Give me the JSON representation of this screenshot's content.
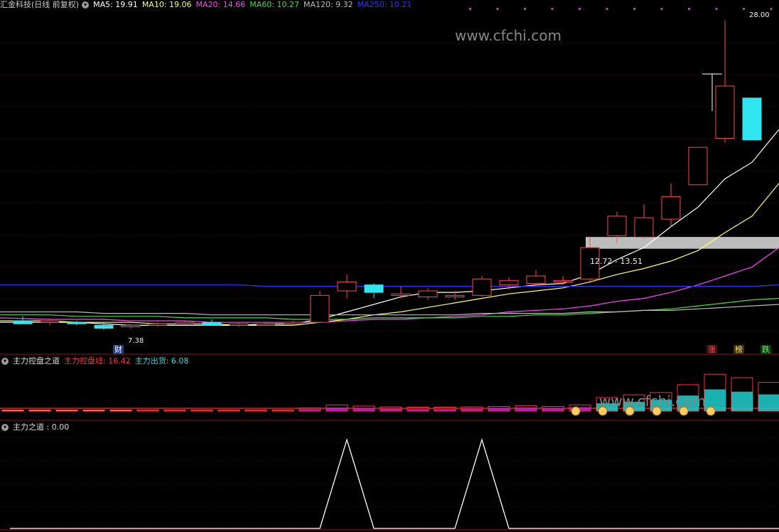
{
  "header": {
    "title": "汇金科技(日线 前复权)",
    "ma": [
      {
        "label": "MA5: 19.91",
        "color": "#ffffff"
      },
      {
        "label": "MA10: 19.06",
        "color": "#ffff66"
      },
      {
        "label": "MA20: 14.66",
        "color": "#ff44ff"
      },
      {
        "label": "MA60: 10.27",
        "color": "#44dd44"
      },
      {
        "label": "MA120: 9.32",
        "color": "#bbbbbb"
      },
      {
        "label": "MA250: 10.21",
        "color": "#3333ff"
      }
    ]
  },
  "price_panel": {
    "high_label": "28.00",
    "low_label": "7.38",
    "range_label": "12.72 - 13.51",
    "cai_label": "财",
    "right_tags": [
      {
        "label": "涨",
        "color": "#ff5555"
      },
      {
        "label": "榜",
        "color": "#ffdd55"
      },
      {
        "label": "跌",
        "color": "#55ff55"
      }
    ]
  },
  "sub1": {
    "title": "主力控盘之道",
    "line1": "主力控盘线: 16.42",
    "line2": "主力出货: 6.08"
  },
  "sub2": {
    "title": "主力之道 : 0.00"
  },
  "watermark": "www.cfchi.com",
  "chart_data": [
    {
      "type": "candlestick",
      "title": "汇金科技(日线 前复权)",
      "candles": [
        {
          "o": 7.9,
          "h": 8.2,
          "l": 7.7,
          "c": 7.7
        },
        {
          "o": 7.8,
          "h": 8.0,
          "l": 7.6,
          "c": 7.9
        },
        {
          "o": 7.8,
          "h": 7.9,
          "l": 7.6,
          "c": 7.7
        },
        {
          "o": 7.6,
          "h": 7.8,
          "l": 7.3,
          "c": 7.4
        },
        {
          "o": 7.5,
          "h": 7.7,
          "l": 7.38,
          "c": 7.6
        },
        {
          "o": 7.6,
          "h": 7.8,
          "l": 7.5,
          "c": 7.7
        },
        {
          "o": 7.7,
          "h": 7.9,
          "l": 7.6,
          "c": 7.8
        },
        {
          "o": 7.8,
          "h": 8.0,
          "l": 7.6,
          "c": 7.6
        },
        {
          "o": 7.6,
          "h": 7.8,
          "l": 7.5,
          "c": 7.7
        },
        {
          "o": 7.7,
          "h": 7.8,
          "l": 7.6,
          "c": 7.7
        },
        {
          "o": 7.7,
          "h": 7.9,
          "l": 7.6,
          "c": 7.8
        },
        {
          "o": 7.8,
          "h": 9.9,
          "l": 7.8,
          "c": 9.6
        },
        {
          "o": 9.9,
          "h": 11.0,
          "l": 9.4,
          "c": 10.5
        },
        {
          "o": 10.3,
          "h": 10.4,
          "l": 9.4,
          "c": 9.8
        },
        {
          "o": 9.6,
          "h": 10.2,
          "l": 9.4,
          "c": 9.7
        },
        {
          "o": 9.5,
          "h": 10.1,
          "l": 9.3,
          "c": 9.9
        },
        {
          "o": 9.5,
          "h": 9.9,
          "l": 9.3,
          "c": 9.6
        },
        {
          "o": 9.6,
          "h": 10.9,
          "l": 9.5,
          "c": 10.7
        },
        {
          "o": 10.3,
          "h": 10.8,
          "l": 10.0,
          "c": 10.6
        },
        {
          "o": 10.4,
          "h": 11.3,
          "l": 10.3,
          "c": 10.9
        },
        {
          "o": 10.5,
          "h": 10.9,
          "l": 10.3,
          "c": 10.6
        },
        {
          "o": 10.7,
          "h": 13.5,
          "l": 10.5,
          "c": 12.8
        },
        {
          "o": 13.6,
          "h": 15.2,
          "l": 13.1,
          "c": 14.9
        },
        {
          "o": 13.5,
          "h": 15.7,
          "l": 13.4,
          "c": 14.8
        },
        {
          "o": 14.7,
          "h": 17.1,
          "l": 14.2,
          "c": 16.2
        },
        {
          "o": 17.0,
          "h": 19.5,
          "l": 17.0,
          "c": 19.5
        },
        {
          "o": 20.1,
          "h": 28.0,
          "l": 19.8,
          "c": 23.6
        },
        {
          "o": 22.8,
          "h": 22.8,
          "l": 20.0,
          "c": 20.0
        }
      ],
      "ylim": [
        7.0,
        28.5
      ],
      "ma_lines": [
        {
          "name": "MA5",
          "values": [
            7.8,
            7.8,
            7.8,
            7.7,
            7.6,
            7.6,
            7.6,
            7.6,
            7.6,
            7.7,
            7.7,
            8.0,
            8.5,
            9.0,
            9.5,
            9.8,
            9.8,
            9.9,
            10.1,
            10.3,
            10.4,
            11.0,
            12.0,
            12.8,
            14.2,
            15.5,
            17.4,
            18.5
          ]
        },
        {
          "name": "MA10",
          "values": [
            7.9,
            7.9,
            7.8,
            7.8,
            7.8,
            7.7,
            7.7,
            7.7,
            7.6,
            7.6,
            7.6,
            7.8,
            8.0,
            8.3,
            8.5,
            8.8,
            9.1,
            9.4,
            9.7,
            9.9,
            10.1,
            10.5,
            11.0,
            11.4,
            11.9,
            12.6,
            13.8,
            14.9
          ]
        },
        {
          "name": "MA20",
          "values": [
            8.1,
            8.0,
            8.0,
            8.0,
            7.9,
            7.9,
            7.9,
            7.8,
            7.8,
            7.8,
            7.8,
            7.8,
            7.9,
            8.0,
            8.0,
            8.1,
            8.2,
            8.3,
            8.5,
            8.6,
            8.7,
            8.9,
            9.2,
            9.4,
            9.8,
            10.3,
            10.9,
            11.5
          ]
        },
        {
          "name": "MA60",
          "values": [
            8.3,
            8.3,
            8.2,
            8.2,
            8.2,
            8.2,
            8.1,
            8.1,
            8.1,
            8.1,
            8.0,
            8.0,
            8.0,
            8.1,
            8.1,
            8.1,
            8.1,
            8.2,
            8.2,
            8.3,
            8.3,
            8.4,
            8.5,
            8.6,
            8.7,
            8.9,
            9.1,
            9.3
          ]
        },
        {
          "name": "MA120",
          "values": [
            8.5,
            8.5,
            8.5,
            8.4,
            8.4,
            8.4,
            8.4,
            8.3,
            8.3,
            8.3,
            8.3,
            8.3,
            8.3,
            8.3,
            8.3,
            8.3,
            8.3,
            8.4,
            8.4,
            8.4,
            8.4,
            8.5,
            8.5,
            8.6,
            8.6,
            8.7,
            8.8,
            8.9
          ]
        },
        {
          "name": "MA250",
          "values": [
            10.3,
            10.3,
            10.3,
            10.3,
            10.3,
            10.3,
            10.3,
            10.3,
            10.3,
            10.2,
            10.2,
            10.2,
            10.2,
            10.2,
            10.2,
            10.2,
            10.2,
            10.2,
            10.2,
            10.2,
            10.2,
            10.2,
            10.2,
            10.2,
            10.2,
            10.2,
            10.2,
            10.2
          ]
        }
      ],
      "highlight_band": [
        12.72,
        13.51
      ]
    },
    {
      "type": "bar",
      "title": "主力控盘之道",
      "series": [
        {
          "name": "主力控盘线",
          "values": [
            0.3,
            0.3,
            0.3,
            0.3,
            0.3,
            0.3,
            0.3,
            0.3,
            0.3,
            0.3,
            0.3,
            0.8,
            1.6,
            1.3,
            1.1,
            1.0,
            1.0,
            1.1,
            1.2,
            1.4,
            1.2,
            1.6,
            3.5,
            4.2,
            4.8,
            6.8,
            9.5,
            8.6,
            7.4
          ]
        },
        {
          "name": "主力出货",
          "values": [
            0.2,
            0.2,
            0.2,
            0.2,
            0.2,
            0.1,
            0.1,
            0.1,
            0.1,
            0.1,
            0.1,
            0.5,
            0.9,
            0.7,
            0.6,
            0.5,
            0.5,
            0.6,
            0.8,
            0.9,
            0.7,
            1.0,
            2.0,
            2.4,
            2.9,
            4.0,
            5.6,
            5.0,
            4.3
          ]
        }
      ],
      "ylim": [
        0,
        11
      ]
    },
    {
      "type": "line",
      "title": "主力之道",
      "values": [
        0,
        0,
        0,
        0,
        0,
        0,
        0,
        0,
        0,
        0,
        0,
        0,
        1,
        0,
        0,
        0,
        0,
        1,
        0,
        0,
        0,
        0,
        0,
        0,
        0,
        0,
        0,
        0
      ],
      "ylim": [
        0,
        1.05
      ]
    }
  ]
}
